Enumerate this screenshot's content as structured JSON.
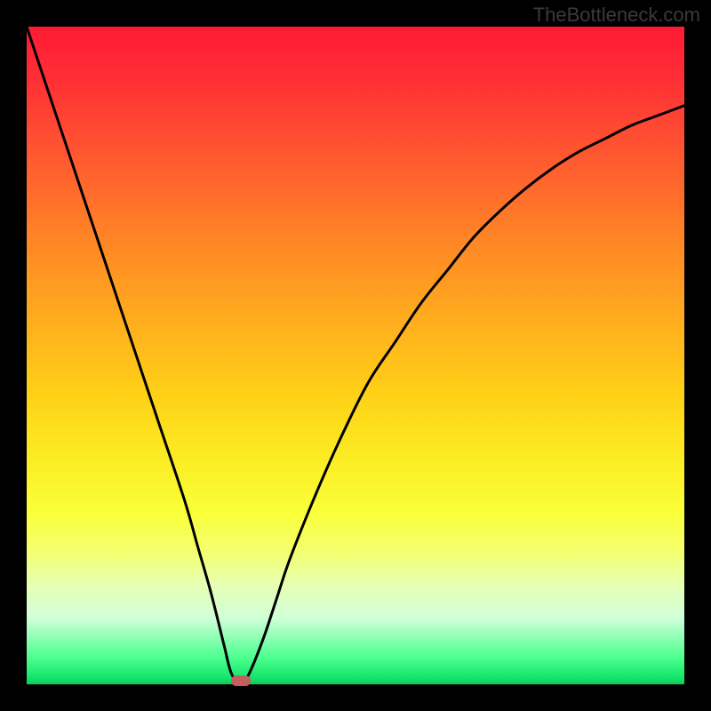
{
  "attribution": "TheBottleneck.com",
  "chart_data": {
    "type": "line",
    "title": "",
    "xlabel": "",
    "ylabel": "",
    "xlim": [
      0,
      100
    ],
    "ylim": [
      0,
      100
    ],
    "x": [
      0,
      4,
      8,
      12,
      16,
      20,
      24,
      26,
      28,
      30,
      31,
      32,
      33,
      34,
      36,
      38,
      40,
      44,
      48,
      52,
      56,
      60,
      64,
      68,
      72,
      76,
      80,
      84,
      88,
      92,
      96,
      100
    ],
    "values": [
      100,
      88,
      76,
      64,
      52,
      40,
      28,
      21,
      14,
      6,
      2,
      0.5,
      0.5,
      2,
      7,
      13,
      19,
      29,
      38,
      46,
      52,
      58,
      63,
      68,
      72,
      75.5,
      78.5,
      81,
      83,
      85,
      86.5,
      88
    ],
    "marker": {
      "x": 32.5,
      "y": 0.5
    },
    "gradient_colors": {
      "top": "#ff1a35",
      "mid": "#fbed23",
      "bottom": "#0fc95b"
    }
  }
}
